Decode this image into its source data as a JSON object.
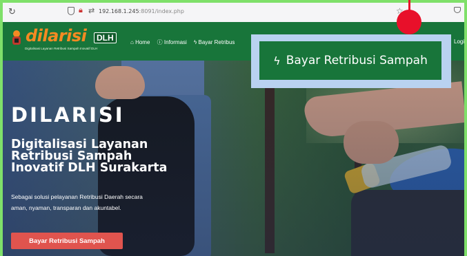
{
  "browser": {
    "url_main": "192.168.1.245",
    "url_rest": ":8091/index.php"
  },
  "logo": {
    "text_part1": "dilarisi",
    "badge": "DLH",
    "tagline": "Digitalisasi Layanan Retribusi Sampah Inovatif DLH"
  },
  "nav": {
    "home": "Home",
    "informasi": "Informasi",
    "bayar": "Bayar Retribus",
    "login": "Login"
  },
  "callout": {
    "label": "Bayar Retribusi Sampah"
  },
  "hero": {
    "title": "DILARISI",
    "subtitle": "Digitalisasi Layanan Retribusi Sampah Inovatif DLH Surakarta",
    "description": "Sebagai solusi pelayanan Retribusi Daerah secara aman, nyaman, transparan dan akuntabel.",
    "button": "Bayar Retribusi Sampah"
  },
  "colors": {
    "header_green": "#18753a",
    "button_red": "#e0544e",
    "pointer_red": "#e8102a",
    "callout_blue": "#b9d2f0",
    "outer_green": "#7fe06a"
  }
}
